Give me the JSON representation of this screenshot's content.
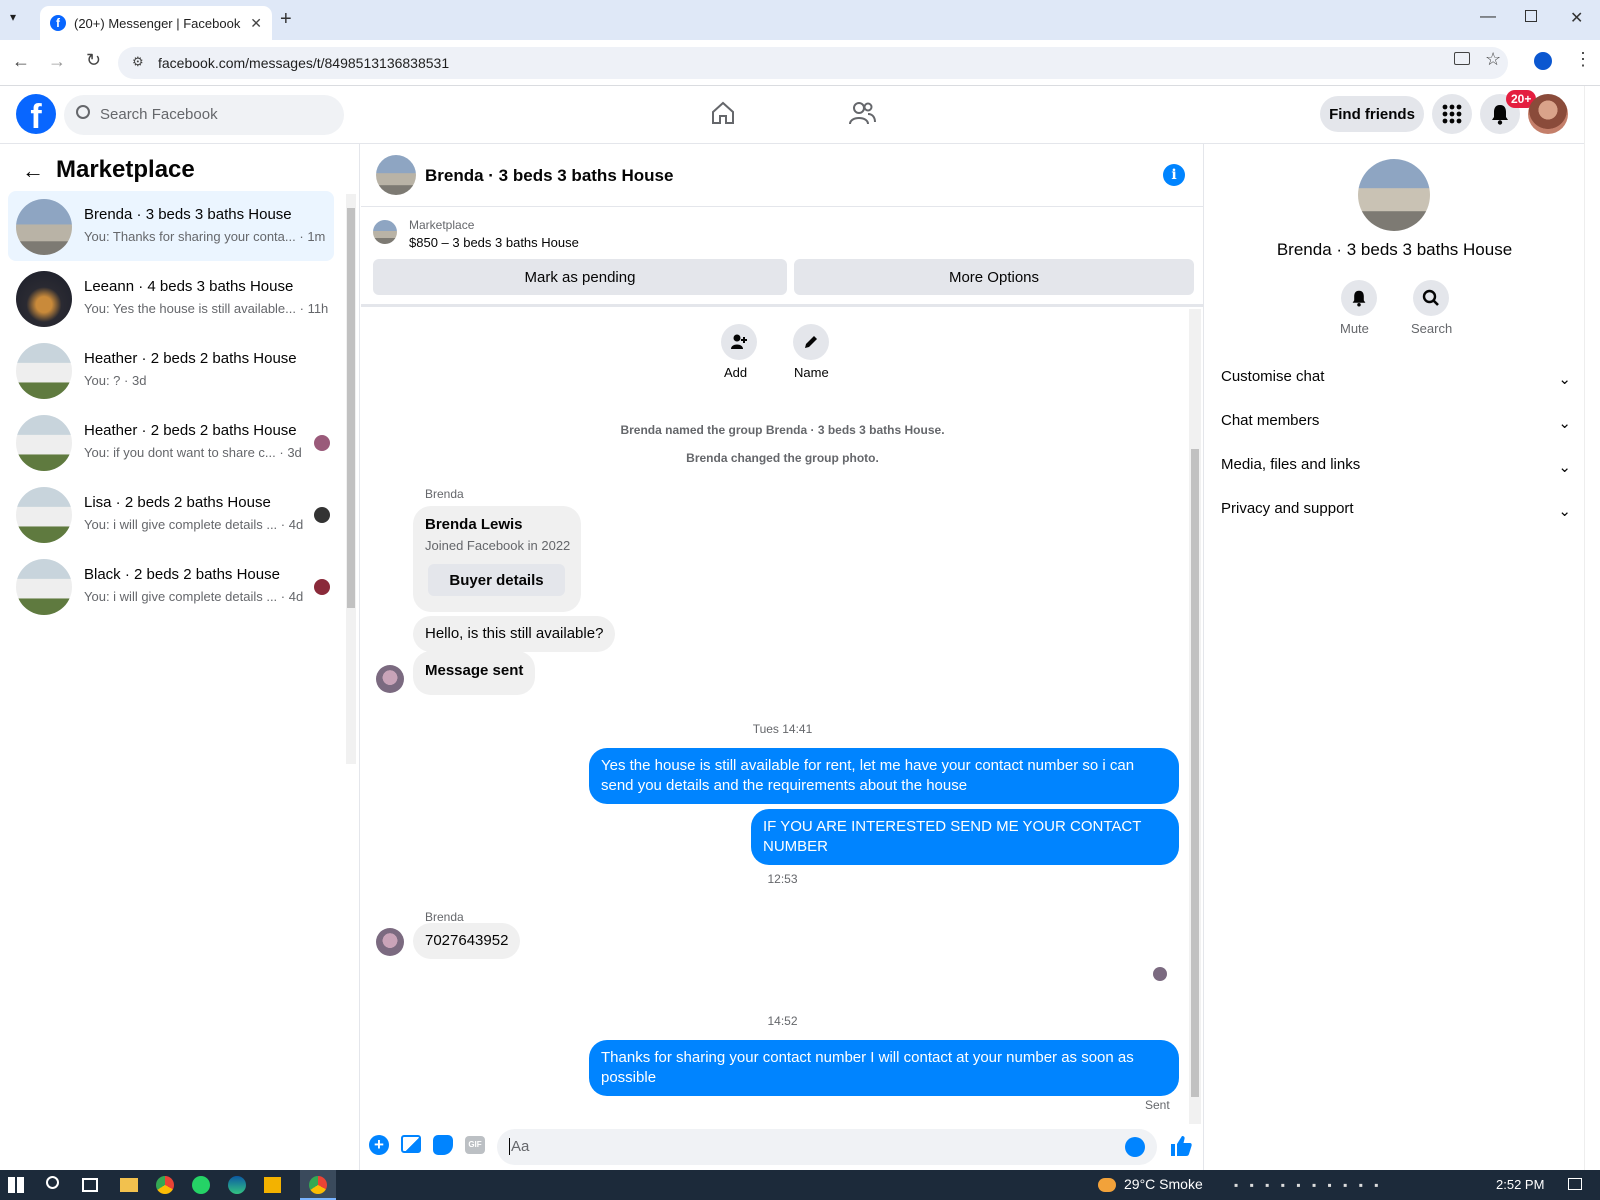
{
  "browser": {
    "tab_title": "(20+) Messenger | Facebook",
    "url": "facebook.com/messages/t/8498513136838531"
  },
  "header": {
    "search_placeholder": "Search Facebook",
    "find_friends": "Find friends",
    "notif_badge": "20+"
  },
  "sidebar": {
    "title": "Marketplace",
    "conversations": [
      {
        "title": "Brenda · 3 beds 3 baths House",
        "snippet": "You: Thanks for sharing your conta...",
        "time": "· 1m",
        "active": true
      },
      {
        "title": "Leeann · 4 beds 3 baths House",
        "snippet": "You: Yes the house is still available...",
        "time": "· 11h"
      },
      {
        "title": "Heather · 2 beds 2 baths House",
        "snippet": "You: ?",
        "time": "· 3d"
      },
      {
        "title": "Heather · 2 beds 2 baths House",
        "snippet": "You: if you dont want to share c...",
        "time": "· 3d"
      },
      {
        "title": "Lisa · 2 beds 2 baths House",
        "snippet": "You: i will give complete details ...",
        "time": "· 4d"
      },
      {
        "title": "Black · 2 beds 2 baths House",
        "snippet": "You: i will give complete details ...",
        "time": "· 4d"
      }
    ]
  },
  "chat": {
    "title": "Brenda · 3 beds 3 baths House",
    "listing_source": "Marketplace",
    "listing": "$850 – 3 beds 3 baths House",
    "mark_pending": "Mark as pending",
    "more_options": "More Options",
    "add_label": "Add",
    "name_label": "Name",
    "sys1": "Brenda named the group Brenda · 3 beds 3 baths House.",
    "sys2": "Brenda changed the group photo.",
    "sender1": "Brenda",
    "card_name": "Brenda Lewis",
    "card_sub": "Joined Facebook in 2022",
    "card_btn": "Buyer details",
    "msg1": "Hello, is this still available?",
    "msg2": "Message sent",
    "time1": "Tues 14:41",
    "out1": "Yes the house is still available for rent, let me have your contact number so i can send you details and the requirements about the house",
    "out2": "IF YOU ARE INTERESTED SEND ME YOUR CONTACT NUMBER",
    "time2": "12:53",
    "sender2": "Brenda",
    "msg3": "7027643952",
    "time3": "14:52",
    "out3": "Thanks for sharing your contact number I will contact at your number as soon as possible",
    "sent": "Sent",
    "composer_placeholder": "Aa"
  },
  "details": {
    "title": "Brenda · 3 beds 3 baths House",
    "mute": "Mute",
    "search": "Search",
    "sections": [
      "Customise chat",
      "Chat members",
      "Media, files and links",
      "Privacy and support"
    ]
  },
  "taskbar": {
    "weather": "29°C  Smoke",
    "clock": "2:52 PM"
  },
  "colors": {
    "accent": "#0084ff",
    "fb_blue": "#0866ff",
    "badge": "#e41e3f"
  }
}
